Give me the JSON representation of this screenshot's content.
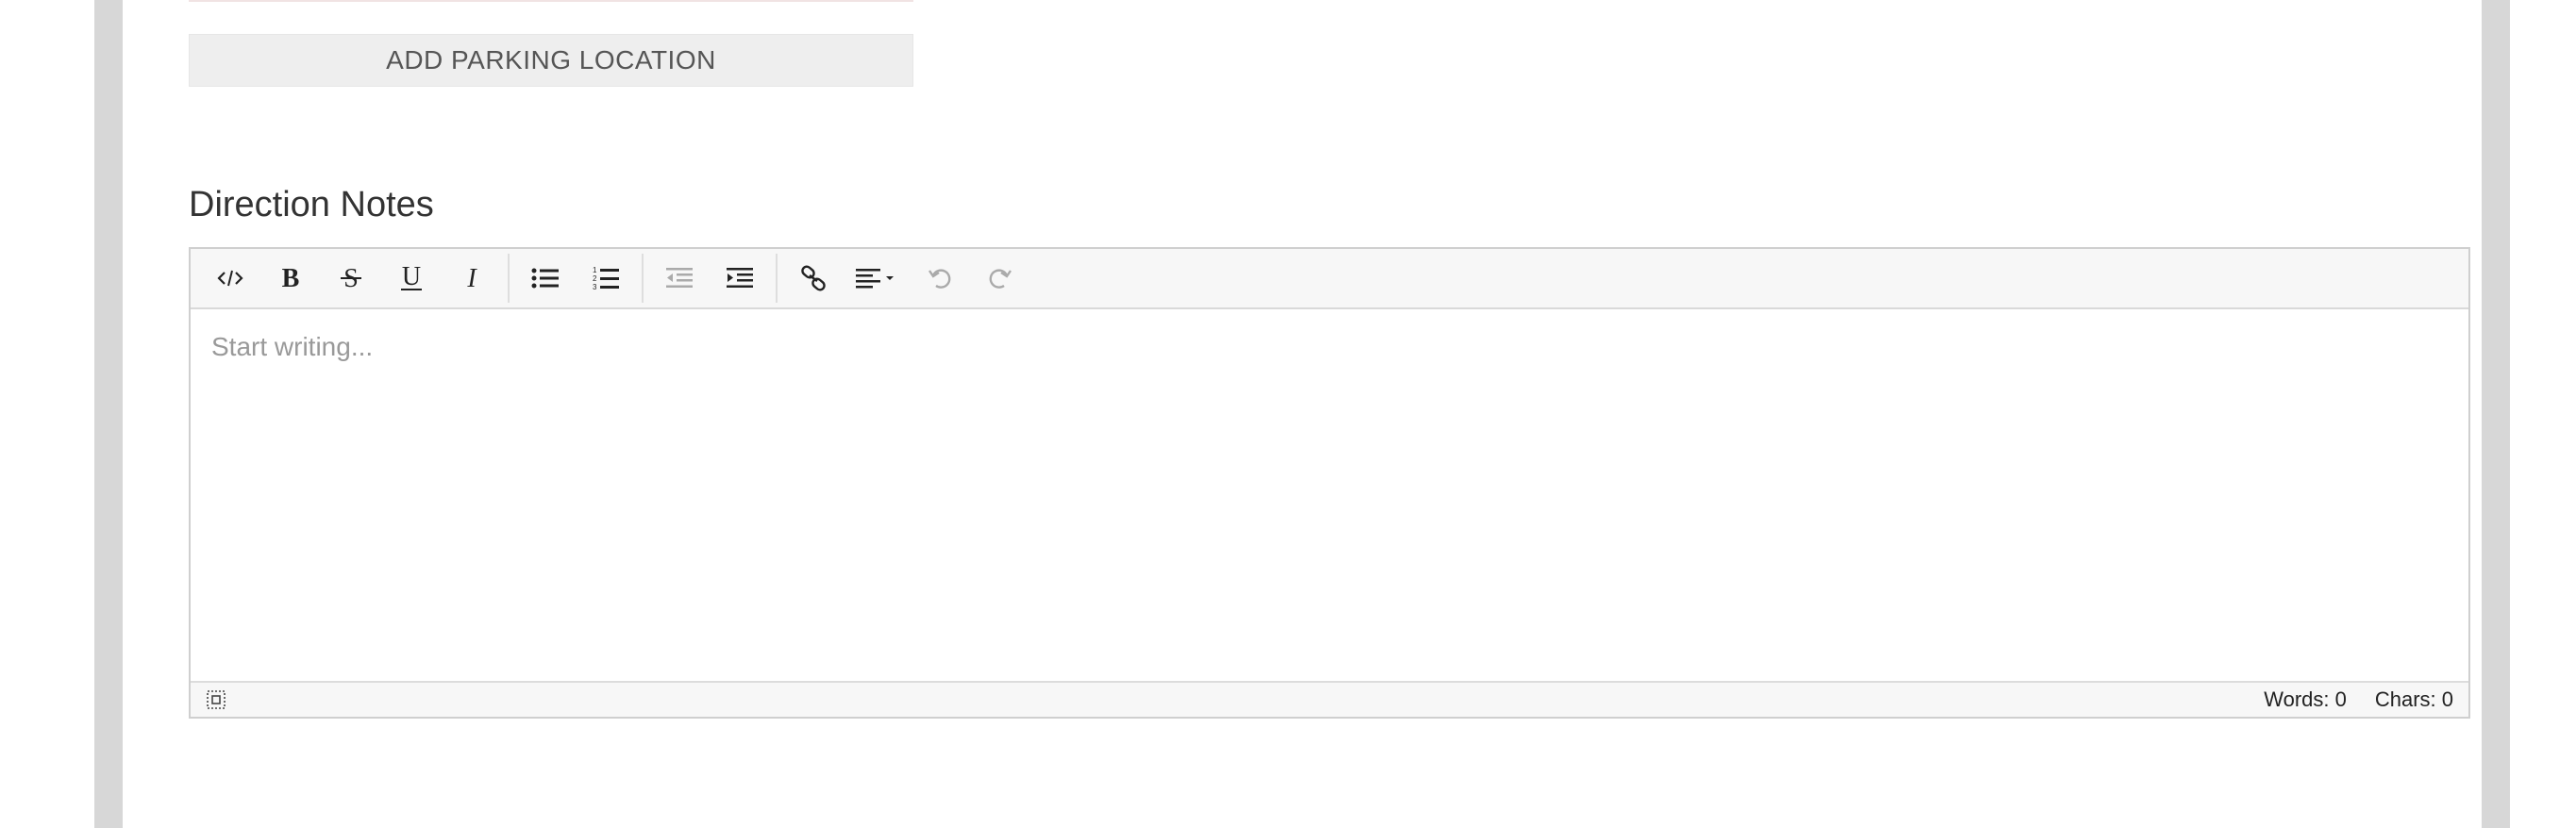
{
  "form": {
    "add_parking_label": "ADD PARKING LOCATION",
    "direction_notes_title": "Direction Notes"
  },
  "editor": {
    "toolbar": [
      {
        "name": "source-code-icon",
        "group": 1
      },
      {
        "name": "bold-icon",
        "group": 1
      },
      {
        "name": "strikethrough-icon",
        "group": 1
      },
      {
        "name": "underline-icon",
        "group": 1
      },
      {
        "name": "italic-icon",
        "group": 1
      },
      {
        "name": "bullet-list-icon",
        "group": 2
      },
      {
        "name": "numbered-list-icon",
        "group": 2
      },
      {
        "name": "outdent-icon",
        "group": 3,
        "disabled": true
      },
      {
        "name": "indent-icon",
        "group": 3
      },
      {
        "name": "link-icon",
        "group": 4
      },
      {
        "name": "align-dropdown-icon",
        "group": 4
      },
      {
        "name": "undo-icon",
        "group": 4,
        "disabled": true
      },
      {
        "name": "redo-icon",
        "group": 4,
        "disabled": true
      }
    ],
    "placeholder": "Start writing...",
    "status": {
      "words": "Words: 0",
      "chars": "Chars: 0"
    }
  },
  "colors": {
    "frame": "#d7d7d7",
    "button_bg": "#eeeeee",
    "toolbar_bg": "#f7f7f7",
    "icon": "#222222",
    "icon_disabled": "#aaaaaa"
  }
}
